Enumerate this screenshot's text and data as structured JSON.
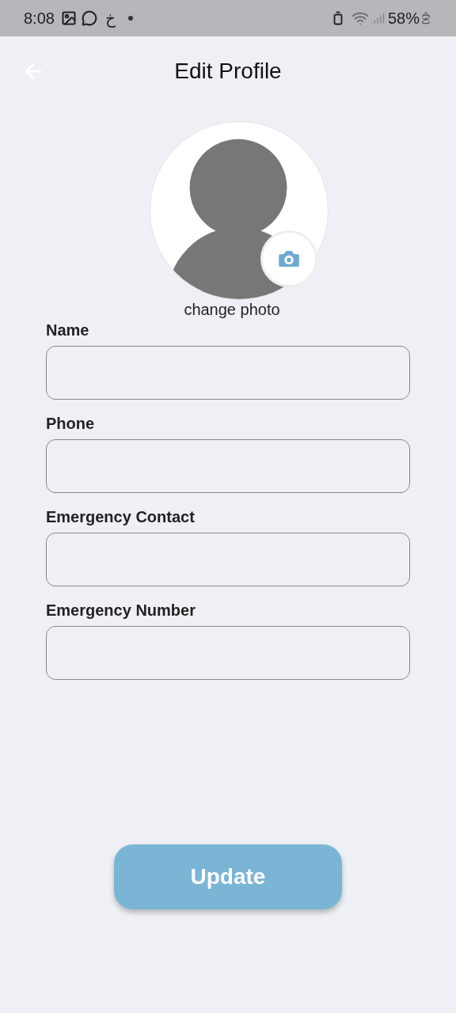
{
  "status_bar": {
    "time": "8:08",
    "app_letter": "خ",
    "battery": "58%"
  },
  "header": {
    "title": "Edit Profile"
  },
  "avatar": {
    "caption": "change photo"
  },
  "fields": [
    {
      "label": "Name"
    },
    {
      "label": "Phone"
    },
    {
      "label": "Emergency Contact"
    },
    {
      "label": "Emergency Number"
    }
  ],
  "update_button": "Update"
}
